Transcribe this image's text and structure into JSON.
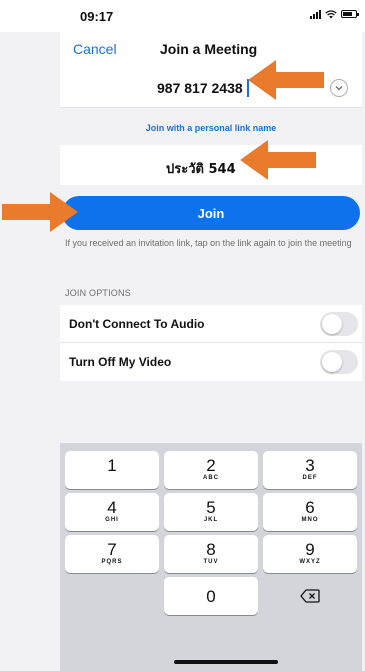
{
  "status_bar": {
    "time": "09:17"
  },
  "nav": {
    "cancel_label": "Cancel",
    "title": "Join a Meeting"
  },
  "meeting_id": {
    "value": "987 817 2438"
  },
  "personal_link": {
    "label": "Join with a personal link name"
  },
  "name_field": {
    "value": "ประวัติ 544"
  },
  "join_button": {
    "label": "Join"
  },
  "hint": {
    "text": "If you received an invitation link, tap on the link again to join the meeting"
  },
  "join_options": {
    "section_label": "JOIN OPTIONS",
    "audio": {
      "label": "Don't Connect To Audio",
      "enabled": false
    },
    "video": {
      "label": "Turn Off My Video",
      "enabled": false
    }
  },
  "keypad": {
    "keys": [
      {
        "num": "1",
        "letters": ""
      },
      {
        "num": "2",
        "letters": "ABC"
      },
      {
        "num": "3",
        "letters": "DEF"
      },
      {
        "num": "4",
        "letters": "GHI"
      },
      {
        "num": "5",
        "letters": "JKL"
      },
      {
        "num": "6",
        "letters": "MNO"
      },
      {
        "num": "7",
        "letters": "PQRS"
      },
      {
        "num": "8",
        "letters": "TUV"
      },
      {
        "num": "9",
        "letters": "WXYZ"
      },
      {
        "num": "0",
        "letters": ""
      }
    ],
    "delete_icon": "backspace-icon"
  },
  "icons": {
    "signal": "signal-icon",
    "wifi": "wifi-icon",
    "battery": "battery-icon",
    "dropdown": "chevron-down-icon",
    "annotation": "arrow-right-icon"
  },
  "colors": {
    "accent": "#0e72ec",
    "link": "#1e6fd9",
    "annotation_arrow": "#ea7a2c"
  }
}
